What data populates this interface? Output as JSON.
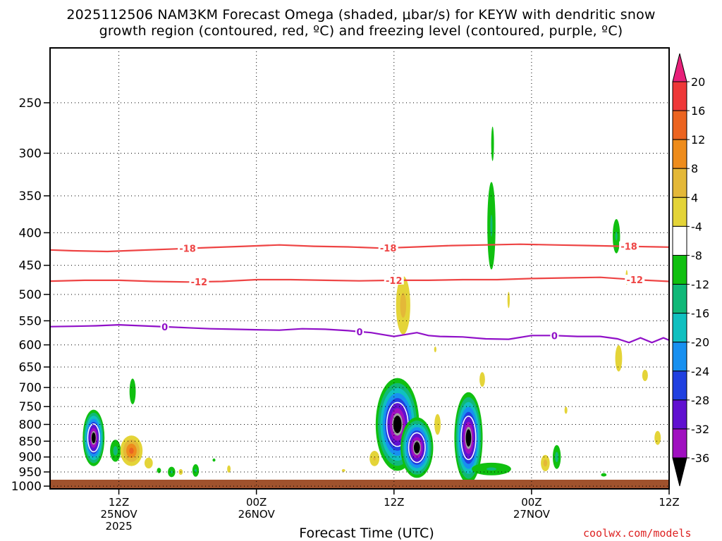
{
  "title_line1": "2025112506 NAM3KM Forecast Omega (shaded, μbar/s) for KEYW with dendritic snow",
  "title_line2": "growth region (contoured, red, ºC) and freezing level (contoured, purple, ºC)",
  "credit": "coolwx.com/models",
  "chart_data": {
    "type": "heatmap",
    "title": "2025112506 NAM3KM Forecast Omega (shaded, μbar/s) for KEYW with dendritic snow growth region (contoured, red, ºC) and freezing level (contoured, purple, ºC)",
    "xlabel": "Forecast Time (UTC)",
    "ylabel": "",
    "x_unit": "forecast hour from 2025-11-25 06Z",
    "x_range": [
      0,
      54
    ],
    "y_scale": "log pressure (hPa), inverted",
    "y_range": [
      1010,
      205
    ],
    "grid": true,
    "x_ticks": [
      {
        "hour": 6,
        "lines": [
          "12Z",
          "25NOV",
          "2025"
        ]
      },
      {
        "hour": 18,
        "lines": [
          "00Z",
          "26NOV"
        ]
      },
      {
        "hour": 30,
        "lines": [
          "12Z"
        ]
      },
      {
        "hour": 42,
        "lines": [
          "00Z",
          "27NOV"
        ]
      },
      {
        "hour": 54,
        "lines": [
          "12Z"
        ]
      }
    ],
    "y_ticks": [
      250,
      300,
      350,
      400,
      450,
      500,
      550,
      600,
      650,
      700,
      750,
      800,
      850,
      900,
      950,
      1000
    ],
    "colorbar": {
      "labels": [
        "20",
        "16",
        "12",
        "8",
        "4",
        "-4",
        "-8",
        "-12",
        "-16",
        "-20",
        "-24",
        "-28",
        "-32",
        "-36"
      ],
      "colors_top_to_bottom": [
        "#e8207a",
        "#ee3838",
        "#ec6420",
        "#ee8c1c",
        "#e4b838",
        "#e4d438",
        "#ffffff",
        "#10c010",
        "#10b878",
        "#10c0c0",
        "#1890f0",
        "#2040e0",
        "#6010d0",
        "#a010c0",
        "#a0a0a0",
        "#000000"
      ]
    },
    "contours": [
      {
        "name": "-18",
        "color": "#ee4444",
        "label": "-18",
        "points": [
          [
            -1,
            425
          ],
          [
            2,
            427
          ],
          [
            5,
            428
          ],
          [
            8,
            426
          ],
          [
            11,
            424
          ],
          [
            14,
            422
          ],
          [
            17,
            420
          ],
          [
            20,
            418
          ],
          [
            23,
            420
          ],
          [
            26,
            421
          ],
          [
            29,
            423
          ],
          [
            32,
            421
          ],
          [
            35,
            419
          ],
          [
            38,
            418
          ],
          [
            41,
            417
          ],
          [
            44,
            418
          ],
          [
            47,
            419
          ],
          [
            50,
            420
          ],
          [
            53,
            421
          ],
          [
            56,
            422
          ],
          [
            58,
            425
          ],
          [
            60,
            423
          ]
        ],
        "label_hours": [
          12,
          29.5,
          50.5
        ]
      },
      {
        "name": "-12",
        "color": "#ee4444",
        "label": "-12",
        "points": [
          [
            -1,
            477
          ],
          [
            3,
            475
          ],
          [
            6,
            475
          ],
          [
            9,
            477
          ],
          [
            12,
            478
          ],
          [
            15,
            477
          ],
          [
            18,
            474
          ],
          [
            21,
            474
          ],
          [
            24,
            475
          ],
          [
            27,
            476
          ],
          [
            30,
            475
          ],
          [
            33,
            475
          ],
          [
            36,
            474
          ],
          [
            39,
            474
          ],
          [
            42,
            472
          ],
          [
            45,
            471
          ],
          [
            48,
            470
          ],
          [
            51,
            474
          ],
          [
            54,
            477
          ],
          [
            57,
            482
          ],
          [
            60,
            486
          ]
        ],
        "label_hours": [
          13,
          30,
          51
        ]
      },
      {
        "name": "0",
        "color": "#9010c8",
        "label": "0",
        "points": [
          [
            -1,
            562
          ],
          [
            2,
            561
          ],
          [
            4,
            560
          ],
          [
            6,
            558
          ],
          [
            8,
            560
          ],
          [
            10,
            562
          ],
          [
            12,
            564
          ],
          [
            14,
            566
          ],
          [
            16,
            567
          ],
          [
            18,
            568
          ],
          [
            20,
            569
          ],
          [
            22,
            566
          ],
          [
            24,
            567
          ],
          [
            26,
            570
          ],
          [
            28,
            574
          ],
          [
            29,
            578
          ],
          [
            30,
            582
          ],
          [
            31,
            578
          ],
          [
            32,
            574
          ],
          [
            33,
            580
          ],
          [
            34,
            582
          ],
          [
            36,
            583
          ],
          [
            38,
            587
          ],
          [
            40,
            588
          ],
          [
            42,
            580
          ],
          [
            44,
            580
          ],
          [
            46,
            582
          ],
          [
            48,
            582
          ],
          [
            49.5,
            587
          ],
          [
            50.5,
            595
          ],
          [
            51.5,
            585
          ],
          [
            52.5,
            595
          ],
          [
            53.5,
            585
          ],
          [
            54.5,
            595
          ],
          [
            55.5,
            590
          ],
          [
            57,
            592
          ],
          [
            60,
            600
          ]
        ],
        "label_hours": [
          10,
          27,
          44
        ]
      }
    ],
    "omega_cells": [
      {
        "hour": 3.8,
        "p": 840,
        "dh": 1.0,
        "dp": 180,
        "min": -40
      },
      {
        "hour": 5.7,
        "p": 880,
        "dh": 0.6,
        "dp": 90,
        "min": -10
      },
      {
        "hour": 7.2,
        "p": 710,
        "dh": 0.45,
        "dp": 110,
        "min": -6
      },
      {
        "hour": 7.1,
        "p": 880,
        "dh": 1.1,
        "dp": 110,
        "max": 18
      },
      {
        "hour": 8.6,
        "p": 920,
        "dh": 0.6,
        "dp": 60,
        "max": 6
      },
      {
        "hour": 9.5,
        "p": 945,
        "dh": 0.3,
        "dp": 30,
        "min": -6
      },
      {
        "hour": 10.6,
        "p": 950,
        "dh": 0.45,
        "dp": 50,
        "min": -8
      },
      {
        "hour": 11.4,
        "p": 950,
        "dh": 0.35,
        "dp": 40,
        "max": 5
      },
      {
        "hour": 12.7,
        "p": 945,
        "dh": 0.4,
        "dp": 60,
        "min": -8
      },
      {
        "hour": 14.3,
        "p": 910,
        "dh": 0.25,
        "dp": 20,
        "min": -5
      },
      {
        "hour": 15.6,
        "p": 940,
        "dh": 0.3,
        "dp": 50,
        "max": 5
      },
      {
        "hour": 25.6,
        "p": 945,
        "dh": 0.3,
        "dp": 15,
        "max": 5
      },
      {
        "hour": 28.3,
        "p": 905,
        "dh": 0.6,
        "dp": 70,
        "max": 8
      },
      {
        "hour": 30.8,
        "p": 520,
        "dh": 0.8,
        "dp": 140,
        "max": 10
      },
      {
        "hour": 30.3,
        "p": 800,
        "dh": 2.0,
        "dp": 280,
        "min": -40
      },
      {
        "hour": 32.0,
        "p": 870,
        "dh": 1.5,
        "dp": 200,
        "min": -40
      },
      {
        "hour": 33.8,
        "p": 800,
        "dh": 0.45,
        "dp": 100,
        "max": 6
      },
      {
        "hour": 33.6,
        "p": 610,
        "dh": 0.2,
        "dp": 25,
        "max": 5
      },
      {
        "hour": 36.5,
        "p": 840,
        "dh": 1.3,
        "dp": 290,
        "min": -40
      },
      {
        "hour": 38.5,
        "p": 940,
        "dh": 2.4,
        "dp": 60,
        "min": -8
      },
      {
        "hour": 37.7,
        "p": 680,
        "dh": 0.4,
        "dp": 60,
        "max": 6
      },
      {
        "hour": 38.5,
        "p": 390,
        "dh": 0.5,
        "dp": 170,
        "min": -8
      },
      {
        "hour": 38.6,
        "p": 290,
        "dh": 0.2,
        "dp": 60,
        "min": -6
      },
      {
        "hour": 40.0,
        "p": 510,
        "dh": 0.2,
        "dp": 60,
        "max": 5
      },
      {
        "hour": 43.2,
        "p": 920,
        "dh": 0.5,
        "dp": 70,
        "max": 10
      },
      {
        "hour": 44.2,
        "p": 900,
        "dh": 0.45,
        "dp": 100,
        "min": -10
      },
      {
        "hour": 45.0,
        "p": 760,
        "dh": 0.25,
        "dp": 40,
        "max": 5
      },
      {
        "hour": 48.3,
        "p": 960,
        "dh": 0.4,
        "dp": 20,
        "min": -6
      },
      {
        "hour": 49.4,
        "p": 405,
        "dh": 0.45,
        "dp": 70,
        "min": -8
      },
      {
        "hour": 50.3,
        "p": 470,
        "dh": 0.15,
        "dp": 50,
        "max": 5
      },
      {
        "hour": 49.6,
        "p": 630,
        "dh": 0.5,
        "dp": 100,
        "max": 6
      },
      {
        "hour": 51.9,
        "p": 670,
        "dh": 0.5,
        "dp": 55,
        "max": 5
      },
      {
        "hour": 53.0,
        "p": 840,
        "dh": 0.55,
        "dp": 85,
        "max": 5
      },
      {
        "hour": 54.7,
        "p": 930,
        "dh": 0.7,
        "dp": 90,
        "min": -14
      },
      {
        "hour": 55.2,
        "p": 660,
        "dh": 0.2,
        "dp": 45,
        "min": -6
      },
      {
        "hour": 56.0,
        "p": 845,
        "dh": 0.7,
        "dp": 130,
        "max": 12
      },
      {
        "hour": 57.4,
        "p": 930,
        "dh": 0.35,
        "dp": 40,
        "max": 5
      }
    ]
  }
}
